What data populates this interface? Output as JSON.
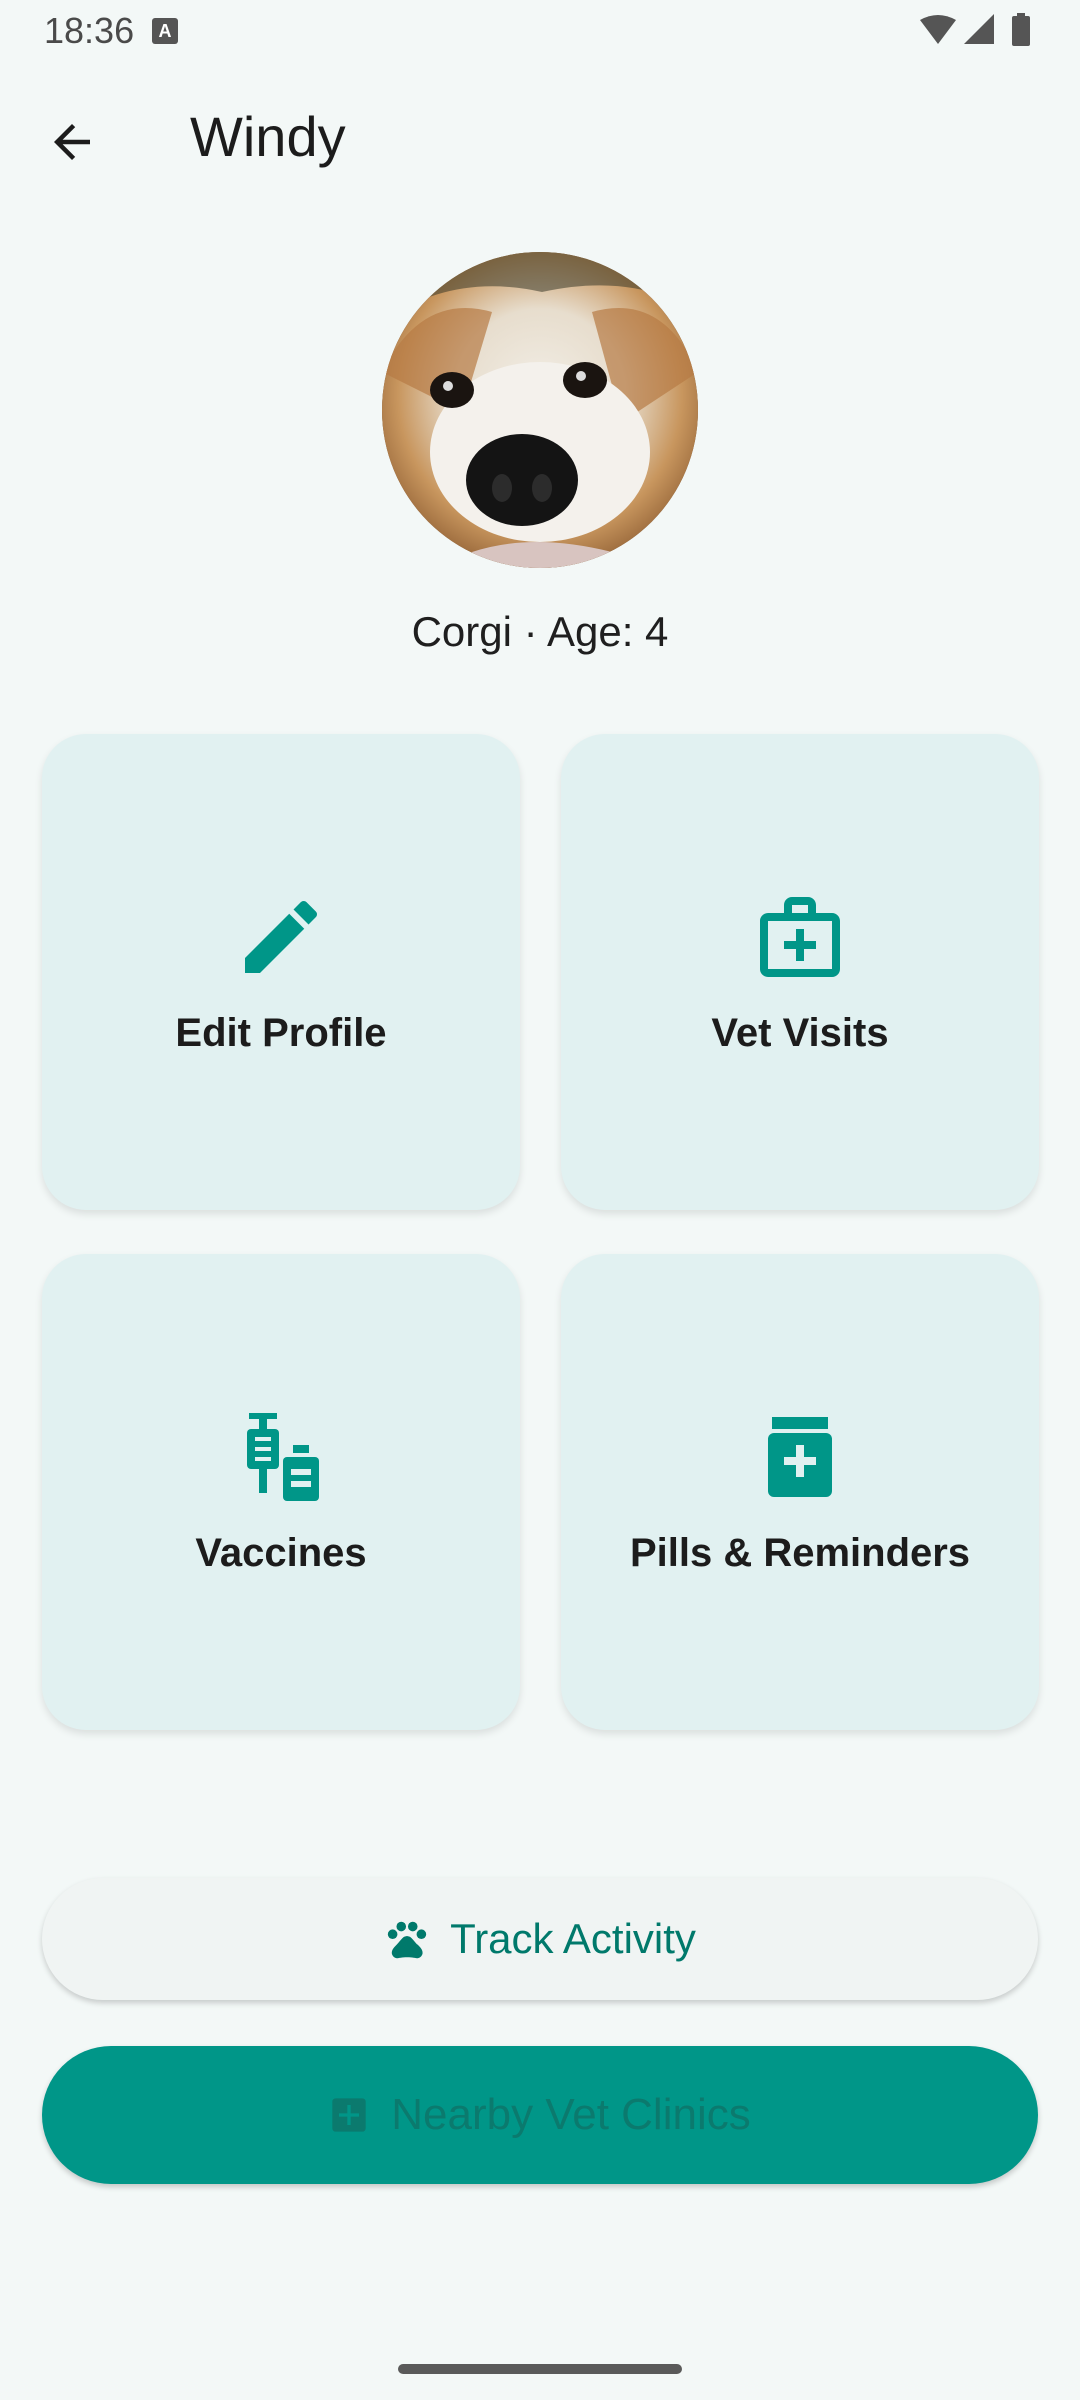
{
  "status_bar": {
    "time": "18:36",
    "notification_icon": "A",
    "icons": [
      "wifi-icon",
      "signal-icon",
      "battery-icon"
    ]
  },
  "app_bar": {
    "title": "Windy",
    "back_icon": "arrow-back-icon"
  },
  "pet": {
    "breed_age": "Corgi · Age: 4"
  },
  "cards": [
    {
      "label": "Edit Profile",
      "icon": "pencil-icon"
    },
    {
      "label": "Vet Visits",
      "icon": "medical-bag-icon"
    },
    {
      "label": "Vaccines",
      "icon": "vaccine-icon"
    },
    {
      "label": "Pills & Reminders",
      "icon": "medication-icon"
    }
  ],
  "buttons": {
    "track_activity": "Track Activity",
    "nearby_clinics": "Nearby Vet Clinics"
  },
  "colors": {
    "accent": "#009688",
    "accent_dark": "#00796b",
    "card_bg": "#e1f1f1",
    "page_bg": "#f3f8f7"
  }
}
